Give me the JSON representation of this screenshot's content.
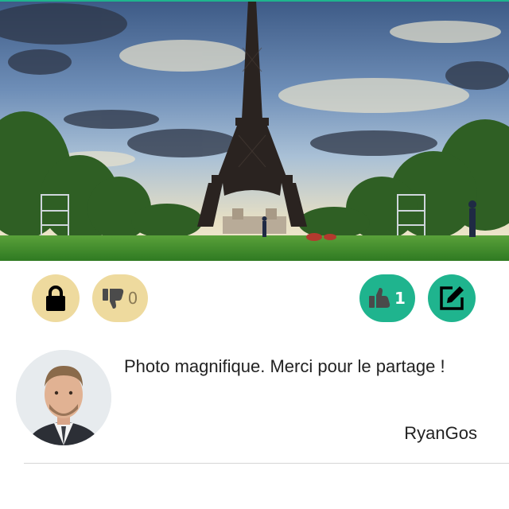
{
  "theme": {
    "accent_color": "#1fb48e",
    "neutral_button_color": "#eeda9e"
  },
  "photo": {
    "subject": "eiffel-tower-landscape"
  },
  "actions": {
    "lock": {
      "icon": "lock-icon"
    },
    "dislike": {
      "icon": "thumbs-down-icon",
      "count": "0"
    },
    "like": {
      "icon": "thumbs-up-icon",
      "count": "1"
    },
    "edit": {
      "icon": "edit-icon"
    }
  },
  "comment": {
    "avatar_icon": "user-avatar",
    "text": "Photo magnifique. Merci pour le partage !",
    "author": "RyanGos"
  }
}
